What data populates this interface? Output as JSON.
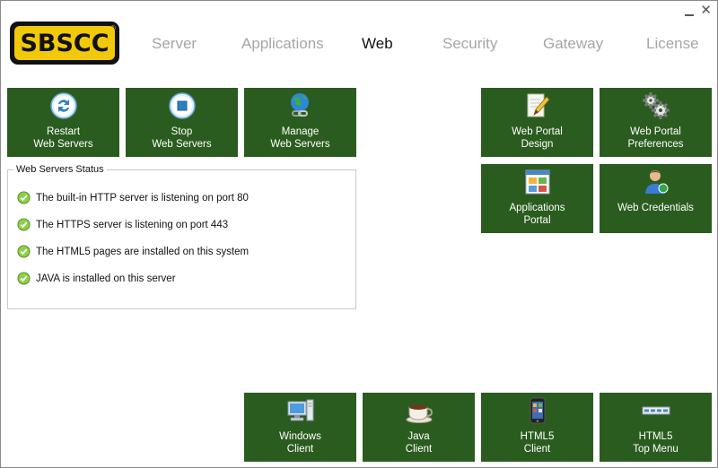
{
  "logo": {
    "text": "SBSCC",
    "reg": "®"
  },
  "window": {
    "close_glyph": "✕"
  },
  "tabs": [
    {
      "label": "Server",
      "active": false
    },
    {
      "label": "Applications",
      "active": false
    },
    {
      "label": "Web",
      "active": true
    },
    {
      "label": "Security",
      "active": false
    },
    {
      "label": "Gateway",
      "active": false
    },
    {
      "label": "License",
      "active": false
    }
  ],
  "tiles": {
    "restart": {
      "line1": "Restart",
      "line2": "Web Servers",
      "icon": "refresh-icon"
    },
    "stop": {
      "line1": "Stop",
      "line2": "Web Servers",
      "icon": "stop-icon"
    },
    "manage": {
      "line1": "Manage",
      "line2": "Web Servers",
      "icon": "globe-link-icon"
    },
    "portal_design": {
      "line1": "Web Portal",
      "line2": "Design",
      "icon": "document-pencil-icon"
    },
    "portal_prefs": {
      "line1": "Web Portal",
      "line2": "Preferences",
      "icon": "gears-icon"
    },
    "apps_portal": {
      "line1": "Applications",
      "line2": "Portal",
      "icon": "app-grid-icon"
    },
    "credentials": {
      "line1": "Web Credentials",
      "line2": "",
      "icon": "user-icon"
    },
    "windows_client": {
      "line1": "Windows",
      "line2": "Client",
      "icon": "computer-icon"
    },
    "java_client": {
      "line1": "Java",
      "line2": "Client",
      "icon": "coffee-cup-icon"
    },
    "html5_client": {
      "line1": "HTML5",
      "line2": "Client",
      "icon": "phone-icon"
    },
    "html5_topmenu": {
      "line1": "HTML5",
      "line2": "Top Menu",
      "icon": "menu-bar-icon"
    }
  },
  "status": {
    "title": "Web Servers Status",
    "items": [
      "The built-in HTTP server is listening on port 80",
      "The HTTPS server is listening on port 443",
      "The HTML5 pages are installed on this system",
      "JAVA is installed on this server"
    ]
  },
  "colors": {
    "tile": "#2b5c1f",
    "logo_yellow": "#f0c90a",
    "tab_inactive": "#a6a6a6"
  }
}
